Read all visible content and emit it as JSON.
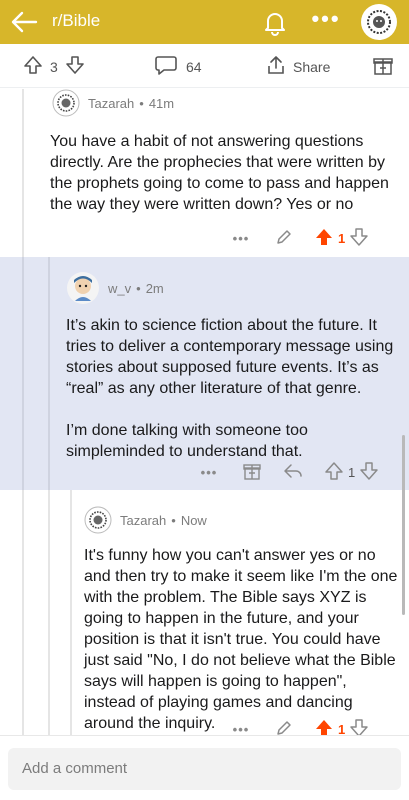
{
  "header": {
    "subreddit": "r/Bible",
    "back_icon": "back-arrow-icon",
    "bell_icon": "bell-icon",
    "more_icon": "more-icon",
    "avatar_icon": "lion-avatar-icon",
    "bg_color": "#d7b62a"
  },
  "post_actions": {
    "vote_count": "3",
    "comment_count": "64",
    "share_label": "Share"
  },
  "comments": [
    {
      "author": "Tazarah",
      "time": "41m",
      "body": [
        "You have a habit of not answering questions directly. Are the prophecies that were written by the prophets going to come to pass and happen the way they were written down? Yes or no"
      ],
      "score": "1",
      "upvoted": true
    },
    {
      "author": "w_v",
      "time": "2m",
      "body": [
        "It’s akin to science fiction about the future. It tries to deliver a contemporary message using stories about supposed future events. It’s as “real” as any other literature of that genre.",
        "I’m done talking with someone too simpleminded to understand that."
      ],
      "score": "1",
      "upvoted": false
    },
    {
      "author": "Tazarah",
      "time": "Now",
      "body": [
        "It's funny how you can't answer yes or no and then try to make it seem like I'm the one with the problem. The Bible says XYZ is going to happen in the future, and your position is that it isn't true. You could have just said \"No, I do not believe what the Bible says will happen is going to happen\", instead of playing games and dancing around the inquiry."
      ],
      "score": "1",
      "upvoted": true
    }
  ],
  "composer": {
    "placeholder": "Add a comment"
  },
  "colors": {
    "upvote": "#ff4500",
    "highlight_bg": "#e2e6f3"
  }
}
